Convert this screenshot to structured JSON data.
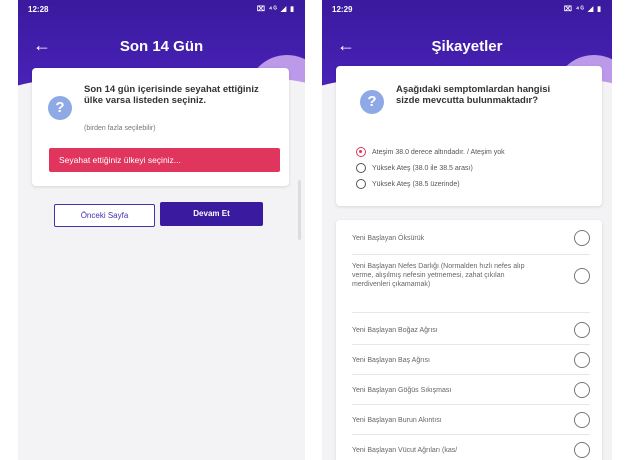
{
  "left_screen": {
    "status_time": "12:28",
    "status_icons": "⌧ ⁴ᴳ ◢ ▮",
    "title": "Son 14 Gün",
    "question": "Son 14 gün içerisinde seyahat ettiğiniz ülke varsa listeden seçiniz.",
    "hint": "(birden fazla seçilebilir)",
    "select_button": "Seyahat ettiğiniz ülkeyi seçiniz...",
    "prev_button": "Önceki Sayfa",
    "next_button": "Devam Et"
  },
  "right_screen": {
    "status_time": "12:29",
    "status_icons": "⌧ ⁴ᴳ ◢ ▮",
    "title": "Şikayetler",
    "question": "Aşağıdaki semptomlardan hangisi sizde mevcutta bulunmaktadır?",
    "fever_options": [
      {
        "label": "Ateşim 38.0 derece altındadır. / Ateşim yok",
        "selected": true
      },
      {
        "label": "Yüksek Ateş (38.0 ile 38.5 arası)",
        "selected": false
      },
      {
        "label": "Yüksek Ateş (38.5 üzerinde)",
        "selected": false
      }
    ],
    "symptoms": [
      "Yeni Başlayan Öksürük",
      "Yeni Başlayan Nefes Darlığı (Normalden hızlı nefes alıp verme, alışılmış nefesin yetmemesi, zahat çıkılan merdivenleri çıkamamak)",
      "Yeni Başlayan Boğaz Ağrısı",
      "Yeni Başlayan Baş Ağrısı",
      "Yeni Başlayan Göğüs Sıkışması",
      "Yeni Başlayan Burun Akıntısı",
      "Yeni Başlayan Vücut Ağrıları (kas/"
    ]
  },
  "colors": {
    "header": "#3a1a9e",
    "accent_pink": "#e0355d",
    "icon_blue": "#8fa8e6"
  }
}
